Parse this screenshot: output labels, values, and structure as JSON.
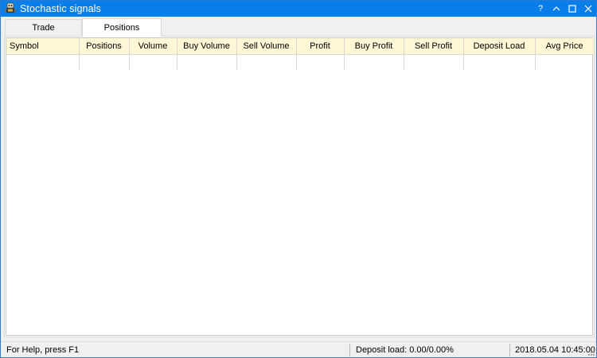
{
  "window": {
    "title": "Stochastic signals",
    "controls": {
      "help": "?"
    }
  },
  "tabs": [
    {
      "label": "Trade",
      "active": false
    },
    {
      "label": "Positions",
      "active": true
    }
  ],
  "table": {
    "columns": [
      "Symbol",
      "Positions",
      "Volume",
      "Buy Volume",
      "Sell Volume",
      "Profit",
      "Buy Profit",
      "Sell Profit",
      "Deposit Load",
      "Avg Price"
    ],
    "rows": [],
    "header_color": "#fff7d6"
  },
  "statusbar": {
    "help_text": "For Help, press F1",
    "deposit_load": "Deposit load: 0.00/0.00%",
    "datetime": "2018.05.04 10:45:00"
  },
  "colors": {
    "titlebar": "#0a7ee8",
    "header": "#fff7d6"
  }
}
